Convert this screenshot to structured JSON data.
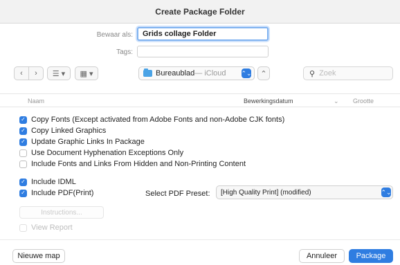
{
  "window": {
    "title": "Create Package Folder"
  },
  "save": {
    "save_as_label": "Bewaar als:",
    "save_as_value": "Grids collage Folder",
    "tags_label": "Tags:",
    "tags_value": ""
  },
  "toolbar": {
    "back_glyph": "‹",
    "forward_glyph": "›",
    "list_view_glyph": "☰ ▾",
    "grid_view_glyph": "▦ ▾",
    "location_name": "Bureaublad",
    "location_sub": " — iCloud",
    "location_chevron": "⌃⌄",
    "expand_glyph": "⌃",
    "search_glyph": "⚲",
    "search_placeholder": "Zoek"
  },
  "columns": {
    "name": "Naam",
    "date": "Bewerkingsdatum",
    "sort_glyph": "⌄",
    "size": "Grootte"
  },
  "options": [
    {
      "label": "Copy Fonts (Except activated from Adobe Fonts and non-Adobe CJK fonts)",
      "checked": true
    },
    {
      "label": "Copy Linked Graphics",
      "checked": true
    },
    {
      "label": "Update Graphic Links In Package",
      "checked": true
    },
    {
      "label": "Use Document Hyphenation Exceptions Only",
      "checked": false
    },
    {
      "label": "Include Fonts and Links From Hidden and Non-Printing Content",
      "checked": false
    },
    {
      "label": "Include IDML",
      "checked": true
    },
    {
      "label": "Include PDF(Print)",
      "checked": true
    },
    {
      "label": "View Report",
      "checked": false,
      "disabled": true
    }
  ],
  "pdf": {
    "preset_label": "Select PDF Preset:",
    "preset_value": "[High Quality Print] (modified)",
    "preset_chevron": "⌃⌄"
  },
  "instructions_label": "Instructions...",
  "footer": {
    "new_folder": "Nieuwe map",
    "cancel": "Annuleer",
    "package": "Package"
  },
  "colors": {
    "accent": "#2f7de1",
    "focus_ring": "#7fb2f0"
  }
}
